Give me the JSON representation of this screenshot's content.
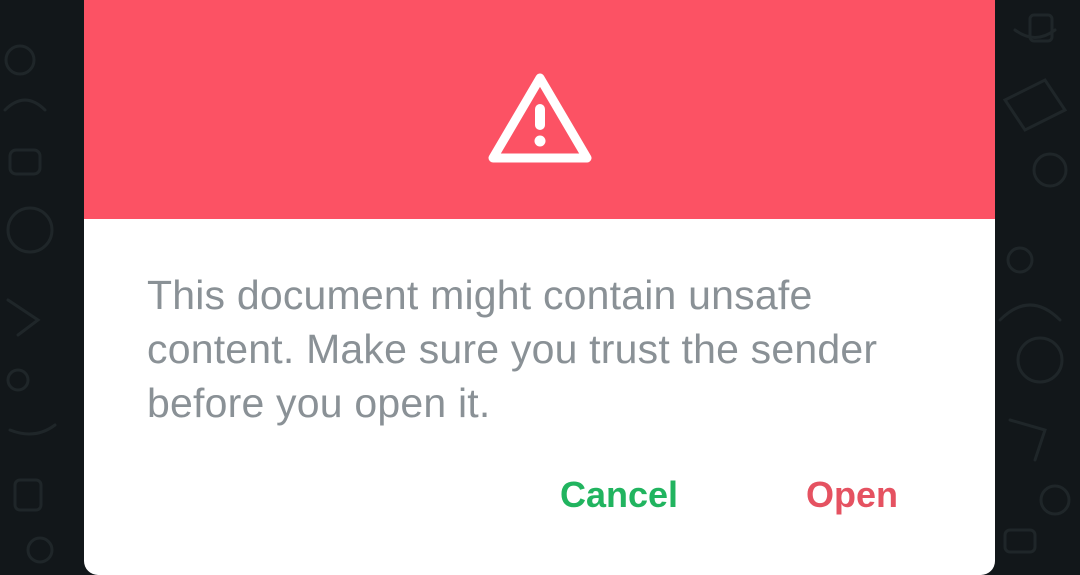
{
  "dialog": {
    "message": "This document might contain unsafe content. Make sure you trust the sender before you open it.",
    "icon": "warning-triangle-icon",
    "cancel_label": "Cancel",
    "open_label": "Open"
  },
  "colors": {
    "header": "#fc5264",
    "cancel": "#21b45f",
    "open": "#e55261",
    "message_text": "#8a9196",
    "backdrop": "#12171a"
  }
}
